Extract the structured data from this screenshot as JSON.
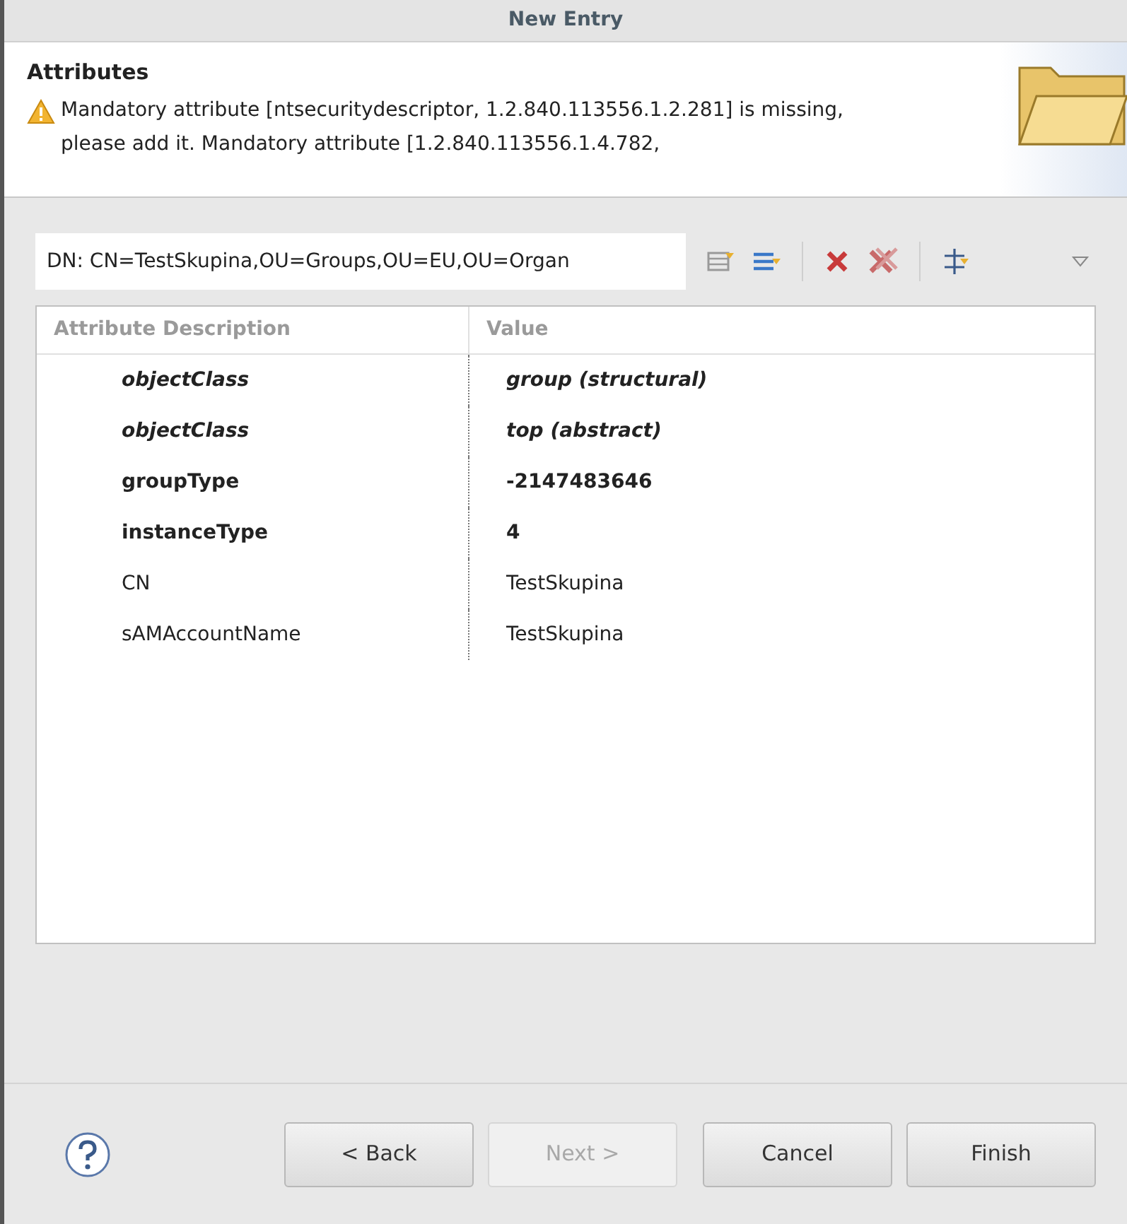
{
  "window": {
    "title": "New Entry"
  },
  "header": {
    "title": "Attributes",
    "message": "Mandatory attribute [ntsecuritydescriptor, 1.2.840.113556.1.2.281] is missing, please add it. Mandatory attribute [1.2.840.113556.1.4.782,"
  },
  "dn_field": {
    "value": "DN: CN=TestSkupina,OU=Groups,OU=EU,OU=Organ"
  },
  "table": {
    "columns": [
      "Attribute Description",
      "Value"
    ],
    "rows": [
      {
        "kind": "objectclass",
        "attribute": "objectClass",
        "value": "group (structural)"
      },
      {
        "kind": "objectclass",
        "attribute": "objectClass",
        "value": "top (abstract)"
      },
      {
        "kind": "must",
        "attribute": "groupType",
        "value": "-2147483646"
      },
      {
        "kind": "must",
        "attribute": "instanceType",
        "value": "4"
      },
      {
        "kind": "may",
        "attribute": "CN",
        "value": "TestSkupina"
      },
      {
        "kind": "may",
        "attribute": "sAMAccountName",
        "value": "TestSkupina"
      }
    ]
  },
  "buttons": [
    {
      "label": "< Back",
      "disabled": false
    },
    {
      "label": "Next >",
      "disabled": true
    },
    {
      "label": "Cancel",
      "disabled": false
    },
    {
      "label": "Finish",
      "disabled": false
    }
  ]
}
